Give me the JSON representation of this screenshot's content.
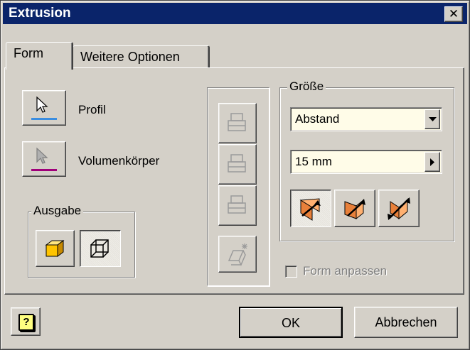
{
  "window": {
    "title": "Extrusion",
    "close_glyph": "✕"
  },
  "tabs": [
    {
      "label": "Form",
      "active": true
    },
    {
      "label": "Weitere Optionen",
      "active": false
    }
  ],
  "selection": {
    "profil_label": "Profil",
    "volumen_label": "Volumenkörper",
    "profil_color": "#3a8de0",
    "volumen_color": "#a0007a"
  },
  "ausgabe": {
    "title": "Ausgabe",
    "options": [
      {
        "icon": "solid-output-icon",
        "selected": false
      },
      {
        "icon": "surface-output-icon",
        "selected": true
      }
    ]
  },
  "operations": [
    {
      "icon": "join-icon",
      "enabled": false
    },
    {
      "icon": "cut-icon",
      "enabled": false
    },
    {
      "icon": "intersect-icon",
      "enabled": false
    },
    {
      "icon": "new-solid-icon",
      "enabled": false
    }
  ],
  "groesse": {
    "title": "Größe",
    "extent_value": "Abstand",
    "distance_value": "15 mm",
    "directions": [
      {
        "icon": "direction-1-icon",
        "selected": true
      },
      {
        "icon": "direction-2-icon",
        "selected": false
      },
      {
        "icon": "symmetric-icon",
        "selected": false
      }
    ]
  },
  "match_shape": {
    "label": "Form anpassen",
    "checked": false,
    "enabled": false
  },
  "footer": {
    "help_glyph": "?",
    "ok_label": "OK",
    "cancel_label": "Abbrechen"
  }
}
